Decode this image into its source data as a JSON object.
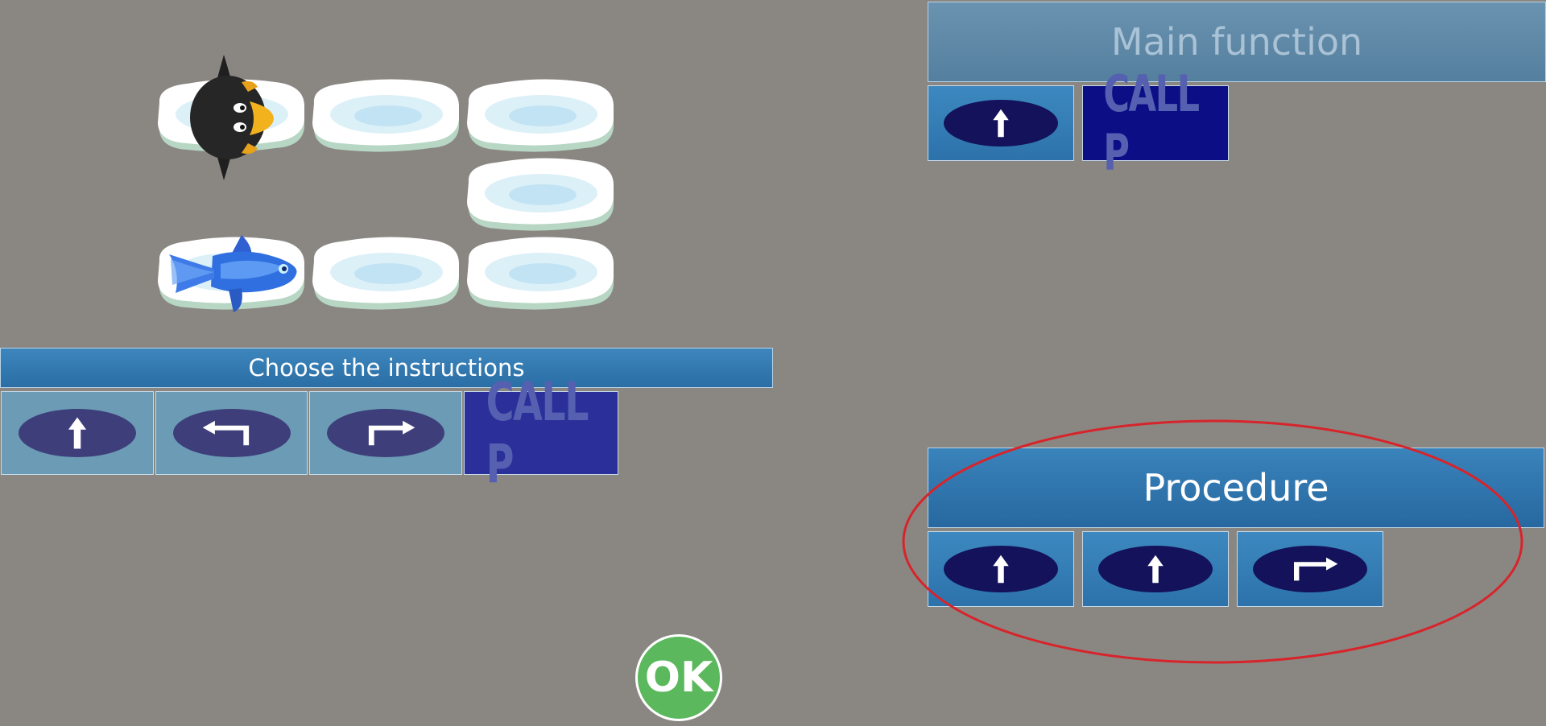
{
  "choose_bar": {
    "label": "Choose the instructions"
  },
  "main_bar": {
    "label": "Main function"
  },
  "procedure_bar": {
    "label": "Procedure"
  },
  "choose_instructions": [
    {
      "icon": "forward-arrow-icon"
    },
    {
      "icon": "turn-left-arrow-icon"
    },
    {
      "icon": "turn-right-arrow-icon"
    },
    {
      "icon": "call-procedure",
      "label": "CALL P"
    }
  ],
  "main_program": [
    {
      "icon": "forward-arrow-icon"
    },
    {
      "icon": "call-procedure",
      "label": "CALL P"
    }
  ],
  "procedure_program": [
    {
      "icon": "forward-arrow-icon"
    },
    {
      "icon": "forward-arrow-icon"
    },
    {
      "icon": "turn-right-arrow-icon"
    }
  ],
  "ok_button": {
    "label": "OK"
  },
  "board": {
    "tiles": [
      "ice-tile",
      "ice-tile",
      "ice-tile",
      "ice-tile",
      "ice-tile",
      "ice-tile",
      "ice-tile"
    ],
    "penguin": "penguin-icon",
    "fish": "fish-icon"
  },
  "colors": {
    "background": "#8a8783",
    "highlight": "#d7242b",
    "ok": "#5bb85d"
  }
}
